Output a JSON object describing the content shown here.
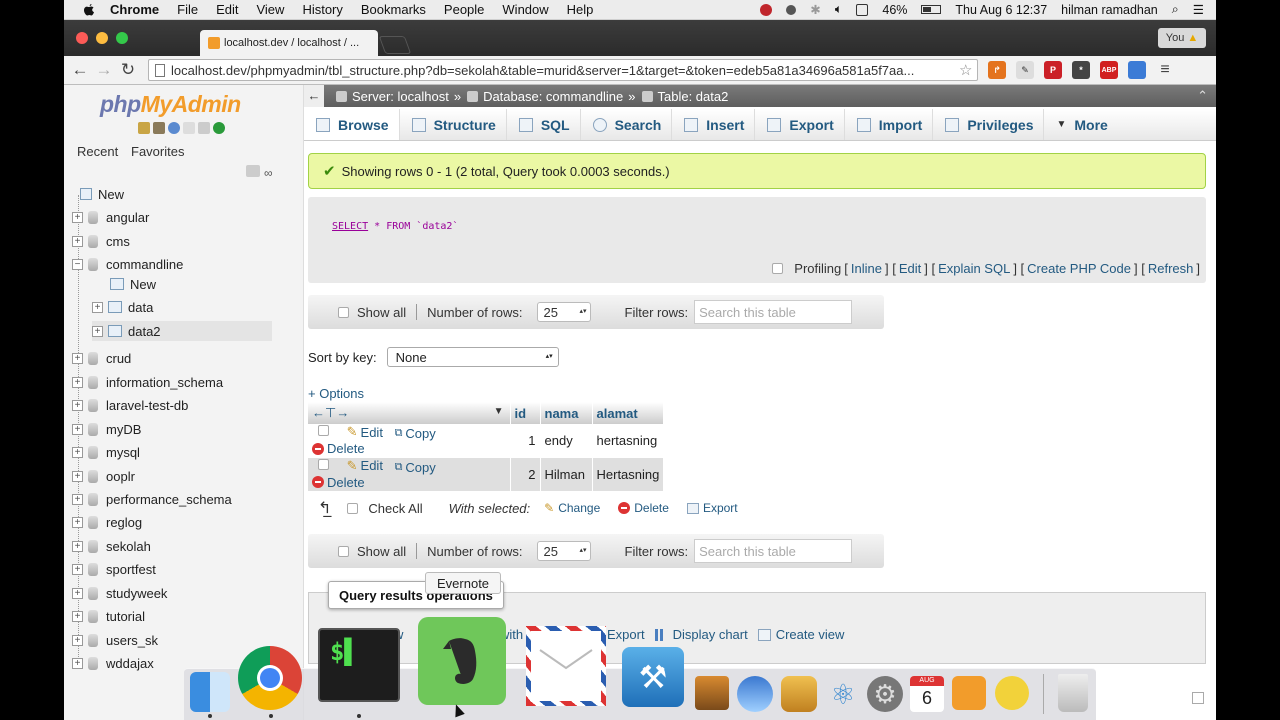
{
  "menubar": {
    "app_name": "Chrome",
    "items": [
      "File",
      "Edit",
      "View",
      "History",
      "Bookmarks",
      "People",
      "Window",
      "Help"
    ],
    "battery": "46%",
    "datetime": "Thu Aug 6  12:37",
    "user": "hilman ramadhan"
  },
  "browser": {
    "tab_title": "localhost.dev / localhost / ...",
    "profile": "You",
    "url": "localhost.dev/phpmyadmin/tbl_structure.php?db=sekolah&table=murid&server=1&target=&token=edeb5a81a34696a581a5f7aa...",
    "extensions": [
      {
        "name": "pinterest-icon",
        "color": "#cb2027",
        "text": "P"
      },
      {
        "name": "puzzle-icon",
        "color": "#444444",
        "text": "*"
      },
      {
        "name": "adblock-icon",
        "color": "#d11f1f",
        "text": "ABP"
      },
      {
        "name": "screenshot-icon",
        "color": "#3b7bd6",
        "text": ""
      }
    ]
  },
  "sidebar": {
    "logo_php": "php",
    "logo_myadmin": "MyAdmin",
    "tabs": [
      "Recent",
      "Favorites"
    ],
    "new_label": "New",
    "databases": [
      {
        "name": "angular"
      },
      {
        "name": "cms"
      },
      {
        "name": "commandline"
      },
      {
        "name": "crud"
      },
      {
        "name": "information_schema"
      },
      {
        "name": "laravel-test-db"
      },
      {
        "name": "myDB"
      },
      {
        "name": "mysql"
      },
      {
        "name": "ooplr"
      },
      {
        "name": "performance_schema"
      },
      {
        "name": "reglog"
      },
      {
        "name": "sekolah"
      },
      {
        "name": "sportfest"
      },
      {
        "name": "studyweek"
      },
      {
        "name": "tutorial"
      },
      {
        "name": "users_sk"
      },
      {
        "name": "wddajax"
      }
    ],
    "commandline_children": [
      "New",
      "data",
      "data2"
    ]
  },
  "breadcrumb": {
    "server": "Server: localhost",
    "database": "Database: commandline",
    "table": "Table: data2"
  },
  "tabs": [
    {
      "label": "Browse",
      "icon": "browse-icon"
    },
    {
      "label": "Structure",
      "icon": "structure-icon"
    },
    {
      "label": "SQL",
      "icon": "sql-icon"
    },
    {
      "label": "Search",
      "icon": "search-icon"
    },
    {
      "label": "Insert",
      "icon": "insert-icon"
    },
    {
      "label": "Export",
      "icon": "export-icon"
    },
    {
      "label": "Import",
      "icon": "import-icon"
    },
    {
      "label": "Privileges",
      "icon": "privileges-icon"
    },
    {
      "label": "More",
      "icon": "more-icon"
    }
  ],
  "success_message": "Showing rows 0 - 1 (2 total, Query took 0.0003 seconds.)",
  "sql": {
    "select_kw": "SELECT",
    "rest": "* FROM `data2`",
    "profiling": "Profiling",
    "links": [
      "Inline",
      "Edit",
      "Explain SQL",
      "Create PHP Code",
      "Refresh"
    ]
  },
  "nav": {
    "show_all": "Show all",
    "rows_label": "Number of rows:",
    "rows_value": "25",
    "filter_label": "Filter rows:",
    "filter_placeholder": "Search this table"
  },
  "sort": {
    "label": "Sort by key:",
    "value": "None"
  },
  "options_link": "+ Options",
  "table": {
    "columns": [
      "id",
      "nama",
      "alamat"
    ],
    "actions": [
      "Edit",
      "Copy",
      "Delete"
    ],
    "rows": [
      {
        "id": "1",
        "nama": "endy",
        "alamat": "hertasning"
      },
      {
        "id": "2",
        "nama": "Hilman",
        "alamat": "Hertasning"
      }
    ]
  },
  "with_selected": {
    "check_all": "Check All",
    "label": "With selected:",
    "actions": [
      "Change",
      "Delete",
      "Export"
    ]
  },
  "query_ops": {
    "legend": "Query results operations",
    "frag1": "w",
    "frag2": "with",
    "links": [
      "Export",
      "Display chart",
      "Create view"
    ]
  },
  "dock": {
    "tooltip": "Evernote",
    "calendar_month": "AUG",
    "calendar_day": "6"
  }
}
